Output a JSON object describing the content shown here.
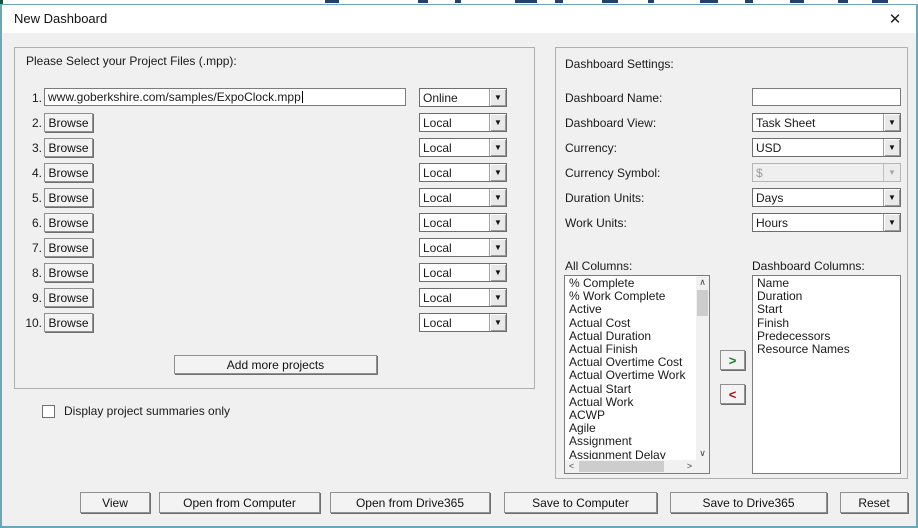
{
  "window": {
    "title": "New Dashboard"
  },
  "icons": {
    "close": "✕",
    "dropdown": "▼",
    "scroll_up": "∧",
    "scroll_down": "∨",
    "scroll_left": "<",
    "scroll_right": ">"
  },
  "project_files": {
    "section_label": "Please Select your Project Files (.mpp):",
    "rows": [
      {
        "num": "1.",
        "type": "input",
        "value": "www.goberkshire.com/samples/ExpoClock.mpp",
        "source": "Online"
      },
      {
        "num": "2.",
        "type": "button",
        "button_label": "Browse",
        "source": "Local"
      },
      {
        "num": "3.",
        "type": "button",
        "button_label": "Browse",
        "source": "Local"
      },
      {
        "num": "4.",
        "type": "button",
        "button_label": "Browse",
        "source": "Local"
      },
      {
        "num": "5.",
        "type": "button",
        "button_label": "Browse",
        "source": "Local"
      },
      {
        "num": "6.",
        "type": "button",
        "button_label": "Browse",
        "source": "Local"
      },
      {
        "num": "7.",
        "type": "button",
        "button_label": "Browse",
        "source": "Local"
      },
      {
        "num": "8.",
        "type": "button",
        "button_label": "Browse",
        "source": "Local"
      },
      {
        "num": "9.",
        "type": "button",
        "button_label": "Browse",
        "source": "Local"
      },
      {
        "num": "10.",
        "type": "button",
        "button_label": "Browse",
        "source": "Local"
      }
    ],
    "add_button_label": "Add more projects",
    "summaries_checkbox_label": "Display project summaries only",
    "summaries_checked": false
  },
  "settings": {
    "section_label": "Dashboard Settings:",
    "fields": [
      {
        "label": "Dashboard Name:",
        "control": "input",
        "value": ""
      },
      {
        "label": "Dashboard View:",
        "control": "select",
        "value": "Task Sheet",
        "disabled": false
      },
      {
        "label": "Currency:",
        "control": "select",
        "value": "USD",
        "disabled": false
      },
      {
        "label": "Currency Symbol:",
        "control": "select",
        "value": "$",
        "disabled": true
      },
      {
        "label": "Duration Units:",
        "control": "select",
        "value": "Days",
        "disabled": false
      },
      {
        "label": "Work Units:",
        "control": "select",
        "value": "Hours",
        "disabled": false
      }
    ]
  },
  "columns": {
    "all_label": "All Columns:",
    "all_items": [
      "% Complete",
      "% Work Complete",
      "Active",
      "Actual Cost",
      "Actual Duration",
      "Actual Finish",
      "Actual Overtime Cost",
      "Actual Overtime Work",
      "Actual Start",
      "Actual Work",
      "ACWP",
      "Agile",
      "Assignment",
      "Assignment Delay"
    ],
    "dashboard_label": "Dashboard Columns:",
    "dashboard_items": [
      "Name",
      "Duration",
      "Start",
      "Finish",
      "Predecessors",
      "Resource Names"
    ],
    "add_arrow": ">",
    "remove_arrow": "<",
    "add_arrow_color": "#1c7c1c",
    "remove_arrow_color": "#aa1111"
  },
  "footer": {
    "buttons": [
      "View",
      "Open from Computer",
      "Open from Drive365",
      "Save to Computer",
      "Save to Drive365",
      "Reset"
    ]
  }
}
